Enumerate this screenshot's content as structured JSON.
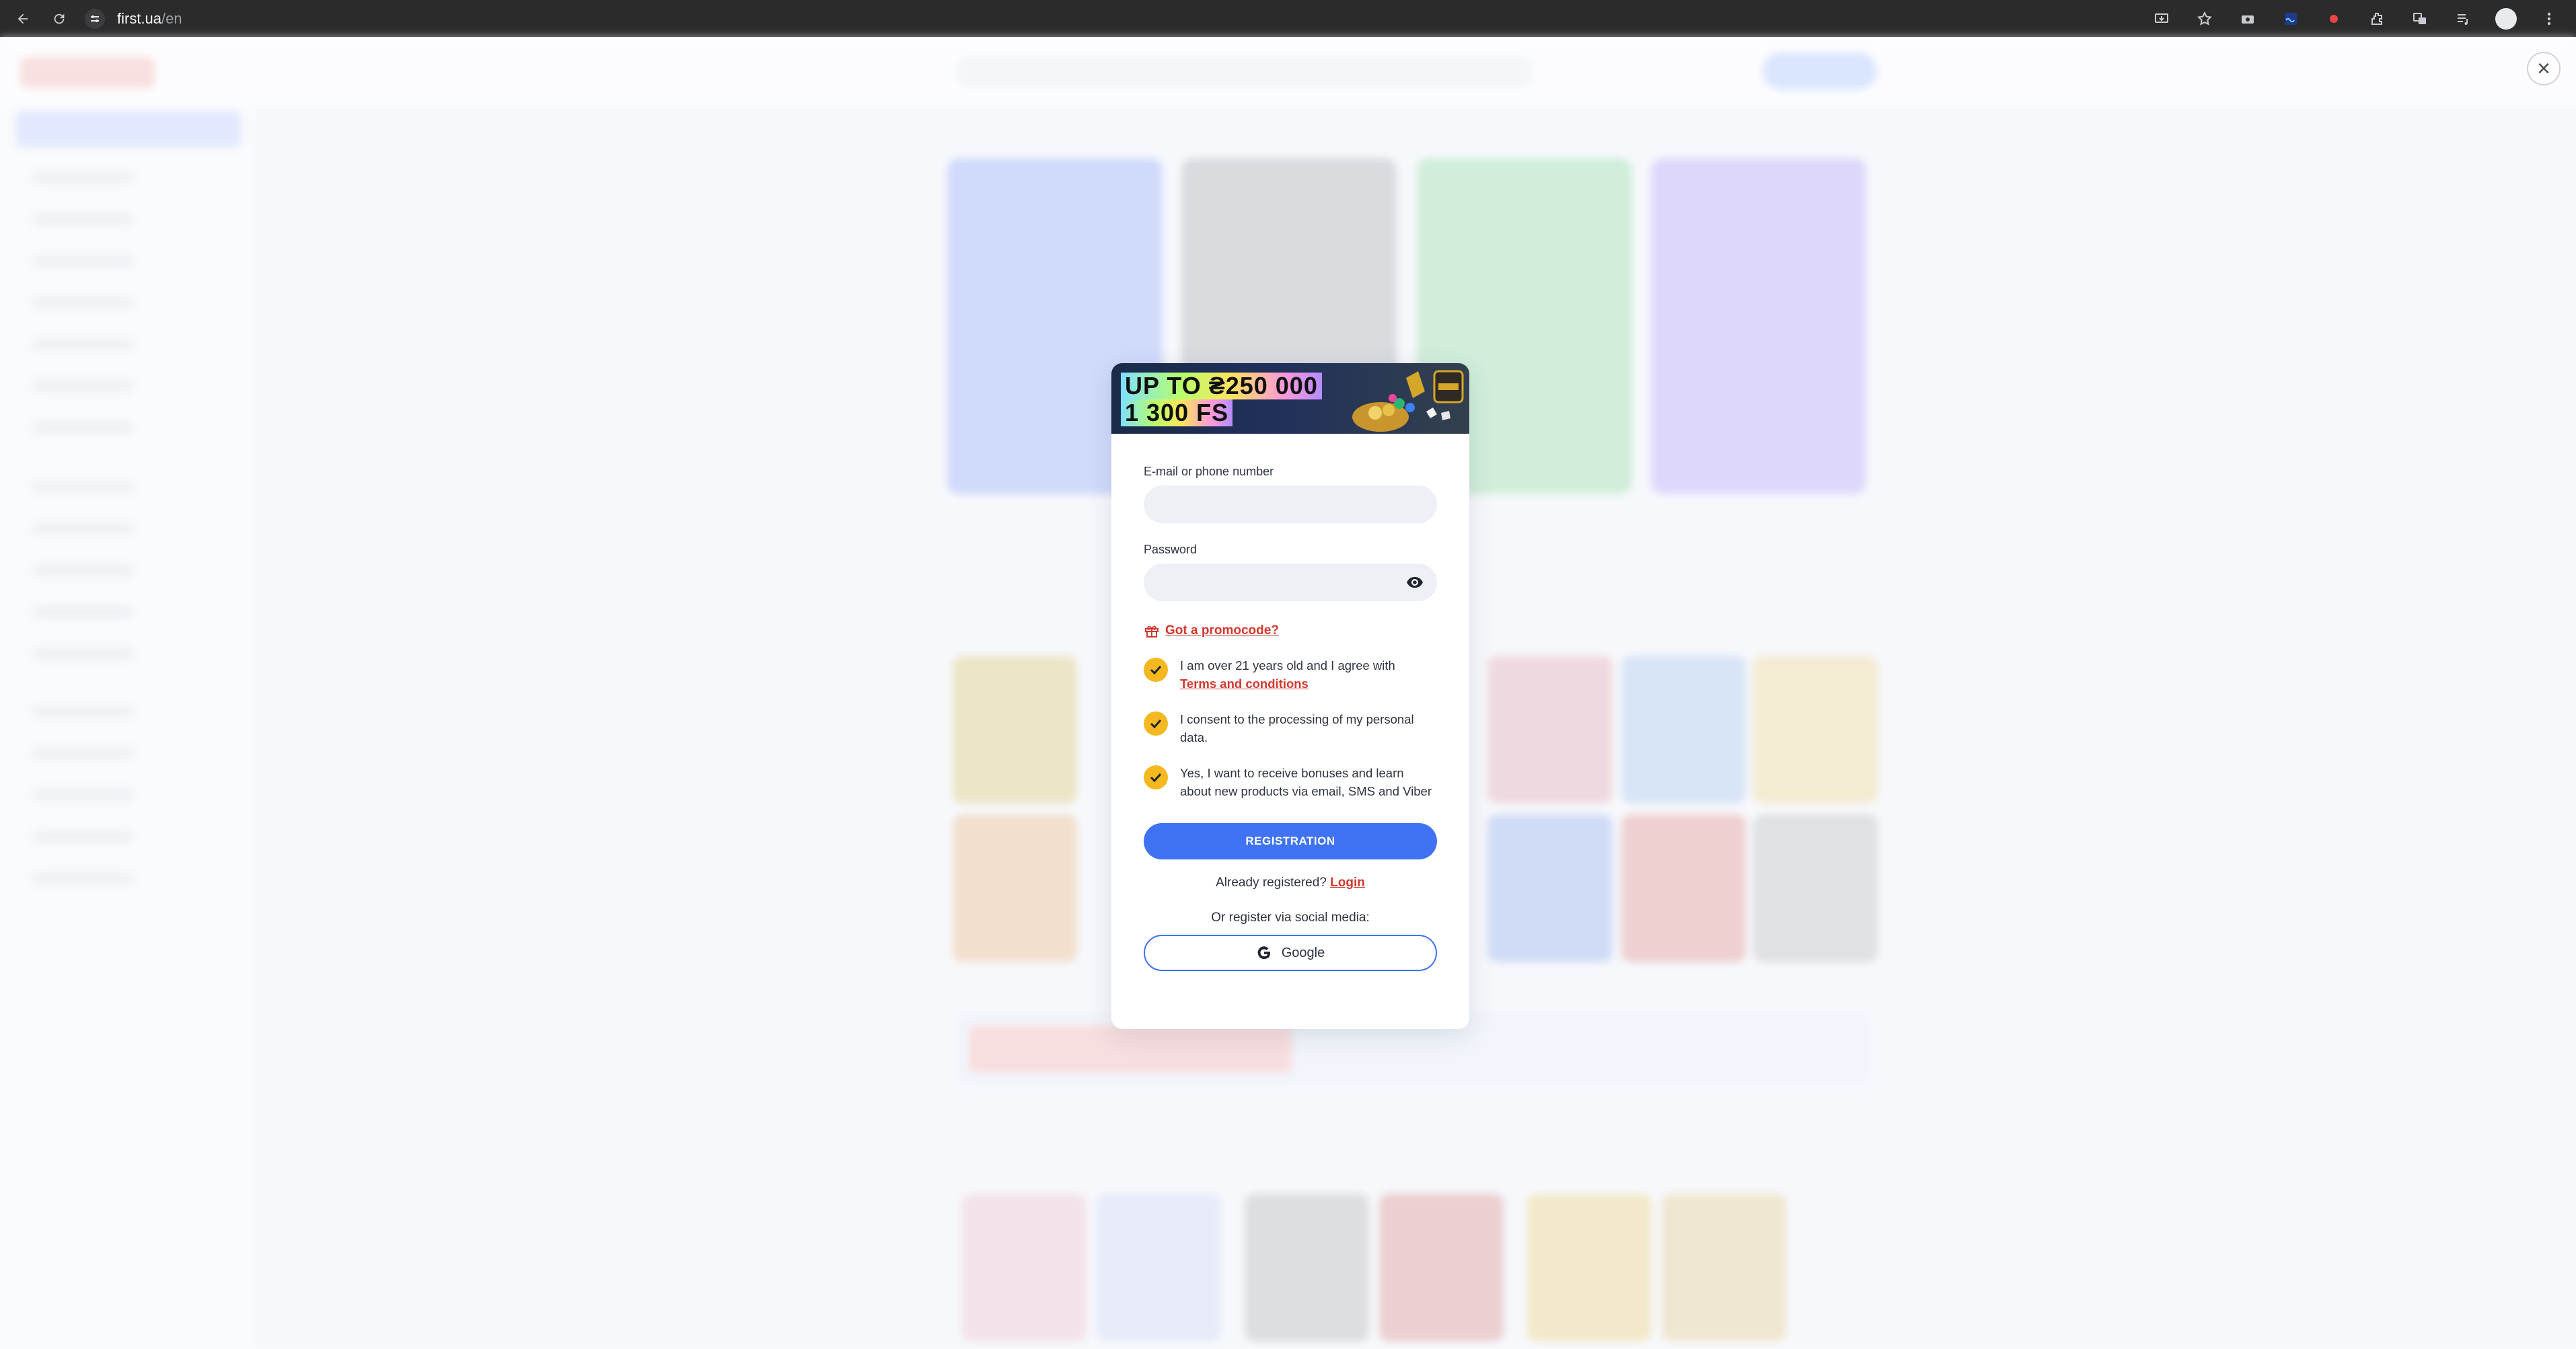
{
  "browser": {
    "url_host": "first.ua",
    "url_path": "/en"
  },
  "promo": {
    "line1": "UP TO ₴250 000",
    "line2": "1 300 FS"
  },
  "form": {
    "email_label": "E-mail or phone number",
    "email_value": "",
    "password_label": "Password",
    "password_value": "",
    "promocode_link": "Got a promocode?",
    "checks": [
      {
        "text": "I am over 21 years old and I agree with",
        "link": "Terms and conditions",
        "checked": true
      },
      {
        "text": "I consent to the processing of my personal data.",
        "checked": true
      },
      {
        "text": "Yes, I want to receive bonuses and learn about new products via email, SMS and Viber",
        "checked": true
      }
    ],
    "register_button": "REGISTRATION",
    "already_registered": "Already registered?",
    "login_link": "Login",
    "social_label": "Or register via social media:",
    "google_button": "Google"
  },
  "colors": {
    "accent_blue": "#3f73f3",
    "link_red": "#d2392f",
    "check_yellow": "#f5b820"
  }
}
